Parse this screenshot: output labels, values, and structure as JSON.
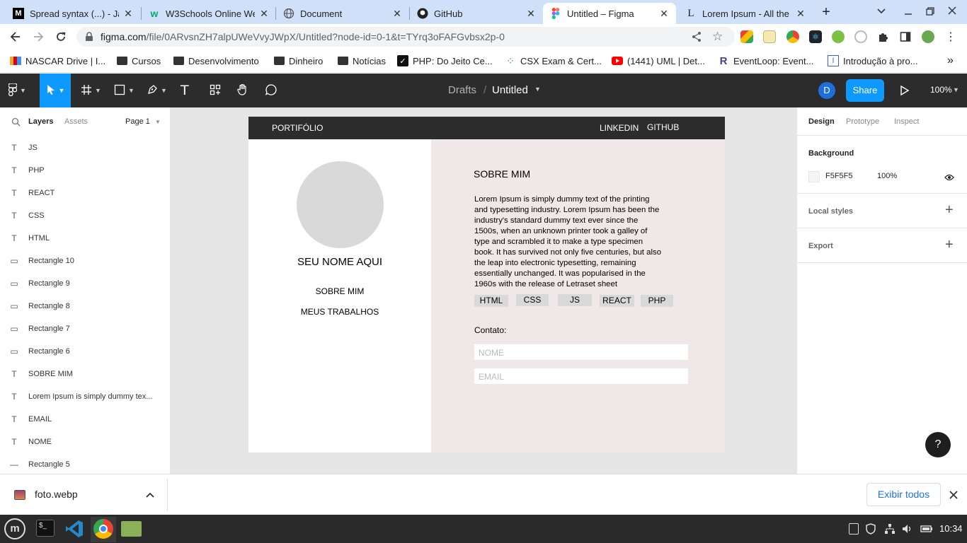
{
  "browser": {
    "tabs": [
      {
        "title": "Spread syntax (...) - Ja",
        "icon": "mdn-icon"
      },
      {
        "title": "W3Schools Online We",
        "icon": "w3schools-icon"
      },
      {
        "title": "Document",
        "icon": "globe-icon"
      },
      {
        "title": "GitHub",
        "icon": "github-icon"
      },
      {
        "title": "Untitled – Figma",
        "icon": "figma-icon"
      },
      {
        "title": "Lorem Ipsum - All the",
        "icon": "lorem-icon"
      }
    ],
    "url_host": "figma.com",
    "url_path": "/file/0ARvsnZH7alpUWeVvyJWpX/Untitled?node-id=0-1&t=TYrq3oFAFGvbsx2p-0",
    "bookmarks": [
      "NASCAR Drive | I...",
      "Cursos",
      "Desenvolvimento",
      "Dinheiro",
      "Notícias",
      "PHP: Do Jeito Ce...",
      "CSX Exam & Cert...",
      "(1441) UML | Det...",
      "EventLoop: Event...",
      "Introdução à pro..."
    ],
    "more_bookmarks": "»"
  },
  "figma": {
    "breadcrumb_parent": "Drafts",
    "breadcrumb_sep": "/",
    "file_name": "Untitled",
    "avatar_letter": "D",
    "share_label": "Share",
    "zoom": "100%",
    "left_tabs": {
      "layers": "Layers",
      "assets": "Assets",
      "page": "Page 1"
    },
    "layers": [
      {
        "name": "JS",
        "kind": "T"
      },
      {
        "name": "PHP",
        "kind": "T"
      },
      {
        "name": "REACT",
        "kind": "T"
      },
      {
        "name": "CSS",
        "kind": "T"
      },
      {
        "name": "HTML",
        "kind": "T"
      },
      {
        "name": "Rectangle 10",
        "kind": "▭"
      },
      {
        "name": "Rectangle 9",
        "kind": "▭"
      },
      {
        "name": "Rectangle 8",
        "kind": "▭"
      },
      {
        "name": "Rectangle 7",
        "kind": "▭"
      },
      {
        "name": "Rectangle 6",
        "kind": "▭"
      },
      {
        "name": "SOBRE MIM",
        "kind": "T"
      },
      {
        "name": "Lorem Ipsum is simply dummy tex...",
        "kind": "T"
      },
      {
        "name": "EMAIL",
        "kind": "T"
      },
      {
        "name": "NOME",
        "kind": "T"
      },
      {
        "name": "Rectangle 5",
        "kind": "—"
      }
    ],
    "right_tabs": {
      "design": "Design",
      "prototype": "Prototype",
      "inspect": "Inspect"
    },
    "background_label": "Background",
    "background_hex": "F5F5F5",
    "background_opacity": "100%",
    "local_styles_label": "Local styles",
    "export_label": "Export",
    "help_label": "?"
  },
  "design": {
    "nav_brand": "PORTIFÓLIO",
    "nav_linkedin": "LINKEDIN",
    "nav_github": "GITHUB",
    "name_placeholder": "SEU NOME AQUI",
    "menu_about": "SOBRE MIM",
    "menu_works": "MEUS TRABALHOS",
    "about_title": "SOBRE MIM",
    "about_lines": [
      "Lorem Ipsum is simply dummy text of the printing",
      "and typesetting industry. Lorem Ipsum has been the",
      "industry's standard dummy text ever since the",
      "1500s, when an unknown printer took a galley of",
      "type and scrambled it to make a type specimen",
      "book. It has survived not only five centuries, but also",
      "the leap into electronic typesetting, remaining",
      "essentially unchanged. It was popularised in the",
      "1960s with the release of Letraset sheet"
    ],
    "tags": [
      "HTML",
      "CSS",
      "JS",
      "REACT",
      "PHP"
    ],
    "contact_label": "Contato:",
    "input_name": "NOME",
    "input_email": "EMAIL"
  },
  "downloads": {
    "file": "foto.webp",
    "show_all": "Exibir todos"
  },
  "taskbar": {
    "time": "10:34"
  },
  "colors": {
    "figma_dark": "#2c2c2c",
    "figma_blue": "#0d99ff",
    "frame_right_bg": "#f0e8e8",
    "avatar": "#1e6fdb"
  }
}
